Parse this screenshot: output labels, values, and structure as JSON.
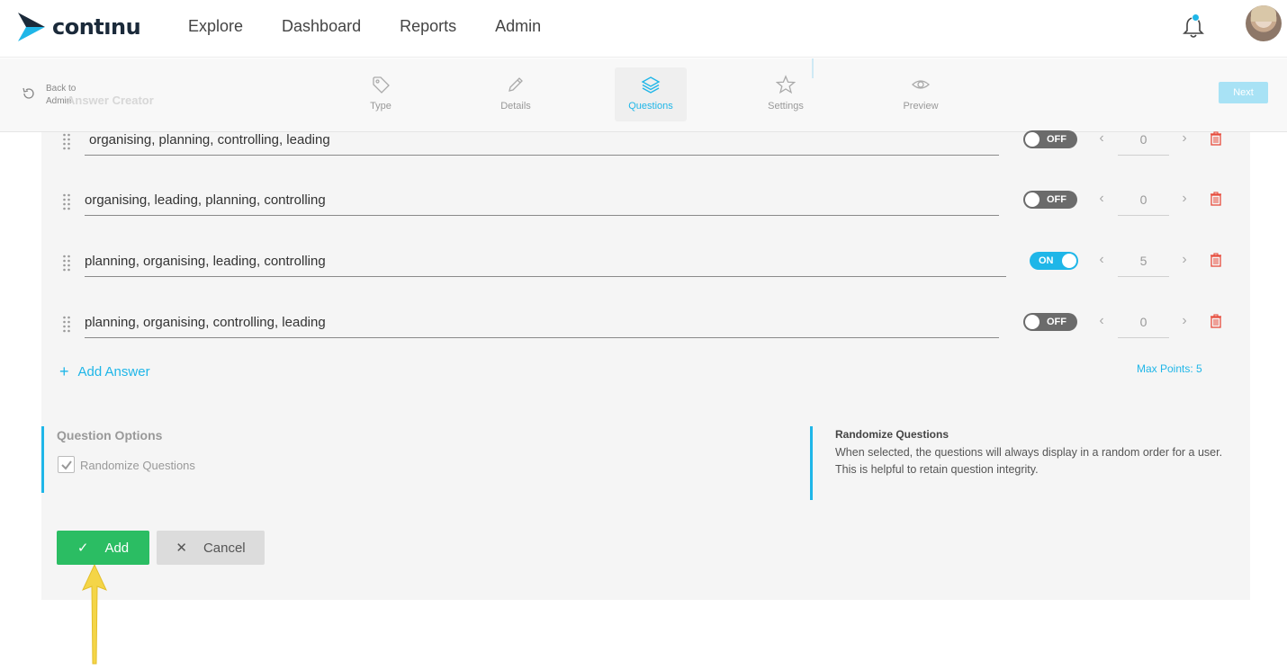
{
  "app": {
    "logo_text": "contınu",
    "nav": [
      "Explore",
      "Dashboard",
      "Reports",
      "Admin"
    ],
    "brand_color": "#1fb6e8"
  },
  "stepbar": {
    "back_label": "Back to Admin",
    "ghost_title": "Answer Creator",
    "steps": [
      {
        "label": "Type",
        "icon": "tag-icon"
      },
      {
        "label": "Details",
        "icon": "pencil-icon"
      },
      {
        "label": "Questions",
        "icon": "layers-icon",
        "active": true
      },
      {
        "label": "Settings",
        "icon": "star-icon"
      },
      {
        "label": "Preview",
        "icon": "eye-icon"
      }
    ],
    "next_label": "Next"
  },
  "answers": [
    {
      "text": "organising, planning, controlling, leading",
      "toggle": "OFF",
      "points": "0"
    },
    {
      "text": "organising, leading, planning, controlling",
      "toggle": "OFF",
      "points": "0"
    },
    {
      "text": "planning, organising, leading, controlling",
      "toggle": "ON",
      "points": "5"
    },
    {
      "text": "planning, organising, controlling, leading",
      "toggle": "OFF",
      "points": "0"
    }
  ],
  "add_answer_label": "Add Answer",
  "max_points_label": "Max Points: 5",
  "options": {
    "title": "Question Options",
    "randomize_label": "Randomize Questions",
    "randomize_checked": true
  },
  "info": {
    "title": "Randomize Questions",
    "text": "When selected, the questions will always display in a random order for a user. This is helpful to retain question integrity."
  },
  "actions": {
    "add_label": "Add",
    "cancel_label": "Cancel"
  }
}
